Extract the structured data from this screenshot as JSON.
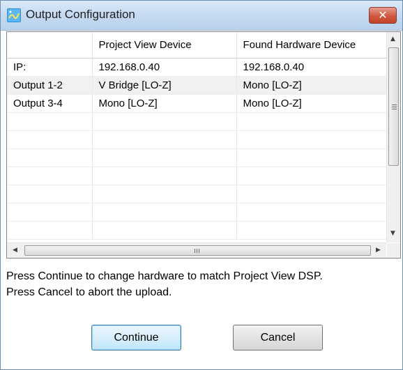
{
  "window": {
    "title": "Output Configuration",
    "close_glyph": "✕",
    "icon": "app-icon"
  },
  "grid": {
    "columns": [
      "",
      "Project View Device",
      "Found Hardware Device"
    ],
    "rows": [
      [
        "IP:",
        "192.168.0.40",
        "192.168.0.40"
      ],
      [
        "Output 1-2",
        "V Bridge [LO-Z]",
        "Mono [LO-Z]"
      ],
      [
        "Output 3-4",
        "Mono [LO-Z]",
        "Mono [LO-Z]"
      ]
    ],
    "hscroll_grip": "III"
  },
  "message": {
    "line1": "Press Continue to change hardware to match Project View DSP.",
    "line2": "Press Cancel to abort the upload."
  },
  "buttons": {
    "continue_label": "Continue",
    "cancel_label": "Cancel"
  },
  "colors": {
    "title_bar": "#c5daf1",
    "close_button": "#d0573f",
    "default_button": "#3c7fb1"
  }
}
